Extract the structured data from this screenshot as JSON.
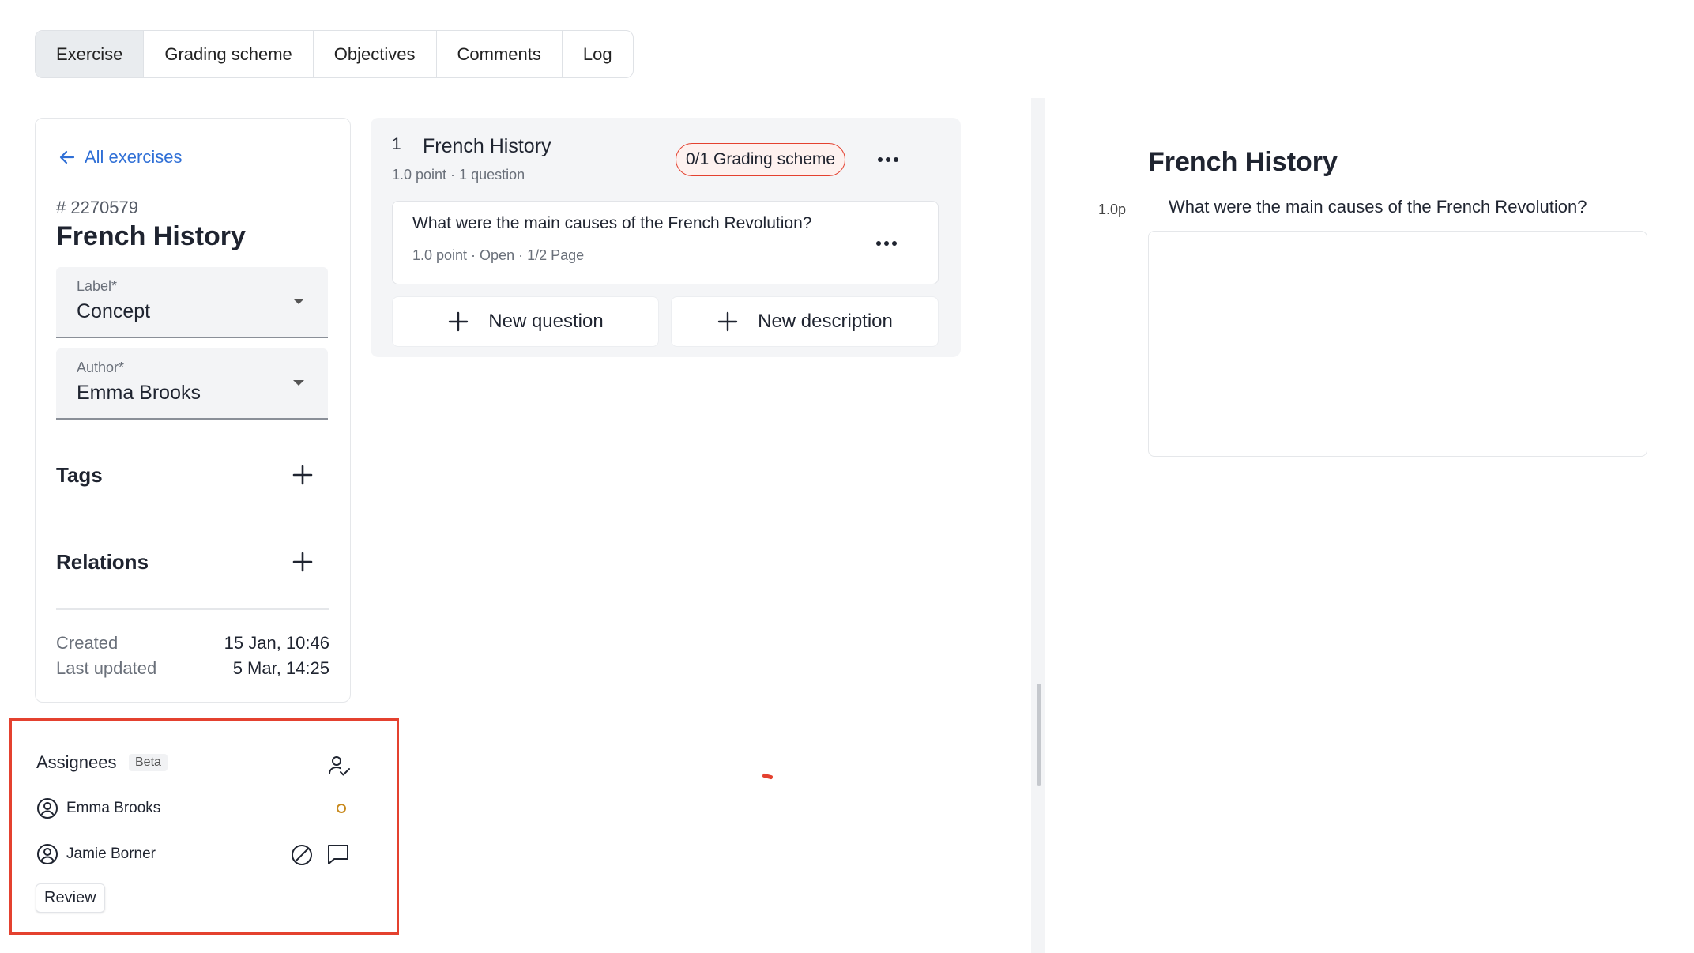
{
  "tabs": [
    {
      "label": "Exercise",
      "active": true
    },
    {
      "label": "Grading scheme",
      "active": false
    },
    {
      "label": "Objectives",
      "active": false
    },
    {
      "label": "Comments",
      "active": false
    },
    {
      "label": "Log",
      "active": false
    }
  ],
  "sidebar": {
    "back_label": "All exercises",
    "exercise_id": "# 2270579",
    "exercise_title": "French History",
    "label_field": {
      "label": "Label*",
      "value": "Concept"
    },
    "author_field": {
      "label": "Author*",
      "value": "Emma Brooks"
    },
    "tags_heading": "Tags",
    "relations_heading": "Relations",
    "created_label": "Created",
    "created_value": "15 Jan, 10:46",
    "updated_label": "Last updated",
    "updated_value": "5 Mar, 14:25"
  },
  "assignees": {
    "title": "Assignees",
    "badge": "Beta",
    "people": [
      {
        "name": "Emma Brooks",
        "status_icon": "pending-circle-icon"
      },
      {
        "name": "Jamie Borner",
        "status_icon": "blocked-icon"
      }
    ],
    "review_label": "Review"
  },
  "question_group": {
    "number": "1",
    "title": "French History",
    "subtitle": "1.0 point · 1 question",
    "grading_badge": "0/1 Grading scheme",
    "question": {
      "text": "What were the main causes of the French Revolution?",
      "meta": "1.0 point · Open · 1/2 Page"
    },
    "new_question_label": "New question",
    "new_description_label": "New description"
  },
  "preview": {
    "title": "French History",
    "points": "1.0p",
    "question": "What were the main causes of the French Revolution?"
  },
  "colors": {
    "accent_blue": "#2f6fd6",
    "highlight_red": "#e4412f",
    "pending_orange": "#c8891c"
  }
}
